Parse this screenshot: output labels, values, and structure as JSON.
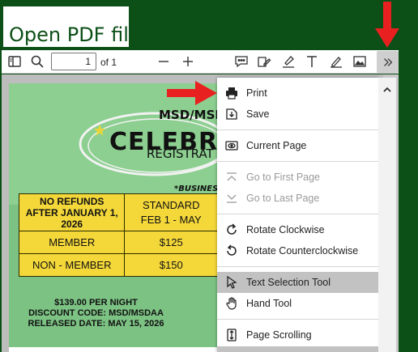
{
  "overlay": {
    "title": "Open PDF file",
    "arrow_color": "#e82020"
  },
  "toolbar": {
    "page_value": "1",
    "page_of": "of 1",
    "icons": [
      "sidebar-toggle-icon",
      "search-icon",
      "zoom-out-icon",
      "zoom-in-icon",
      "comment-icon",
      "sign-icon",
      "highlight-icon",
      "text-icon",
      "draw-icon",
      "image-icon",
      "more-icon"
    ]
  },
  "flyer": {
    "headline1": "MSD/MSD",
    "headline2": "CELEBRA",
    "headline3": "REGISTRAT",
    "business": "*BUSINESS",
    "table": {
      "header_left": "NO REFUNDS AFTER JANUARY 1, 2026",
      "header_right_1": "STANDARD",
      "header_right_2": "FEB 1 - MAY",
      "rows": [
        {
          "label": "MEMBER",
          "value": "$125"
        },
        {
          "label": "NON - MEMBER",
          "value": "$150"
        }
      ]
    },
    "footer_line1": "$139.00 PER NIGHT",
    "footer_line2": "DISCOUNT CODE: MSD/MSDAA",
    "footer_line3": "RELEASED DATE: MAY 15, 2026",
    "colors": {
      "background": "#7cc283",
      "table": "#f4d83a"
    }
  },
  "menu": {
    "print": "Print",
    "save": "Save",
    "current_page": "Current Page",
    "first_page": "Go to First Page",
    "last_page": "Go to Last Page",
    "rotate_cw": "Rotate Clockwise",
    "rotate_ccw": "Rotate Counterclockwise",
    "text_selection": "Text Selection Tool",
    "hand_tool": "Hand Tool",
    "page_scrolling": "Page Scrolling"
  }
}
